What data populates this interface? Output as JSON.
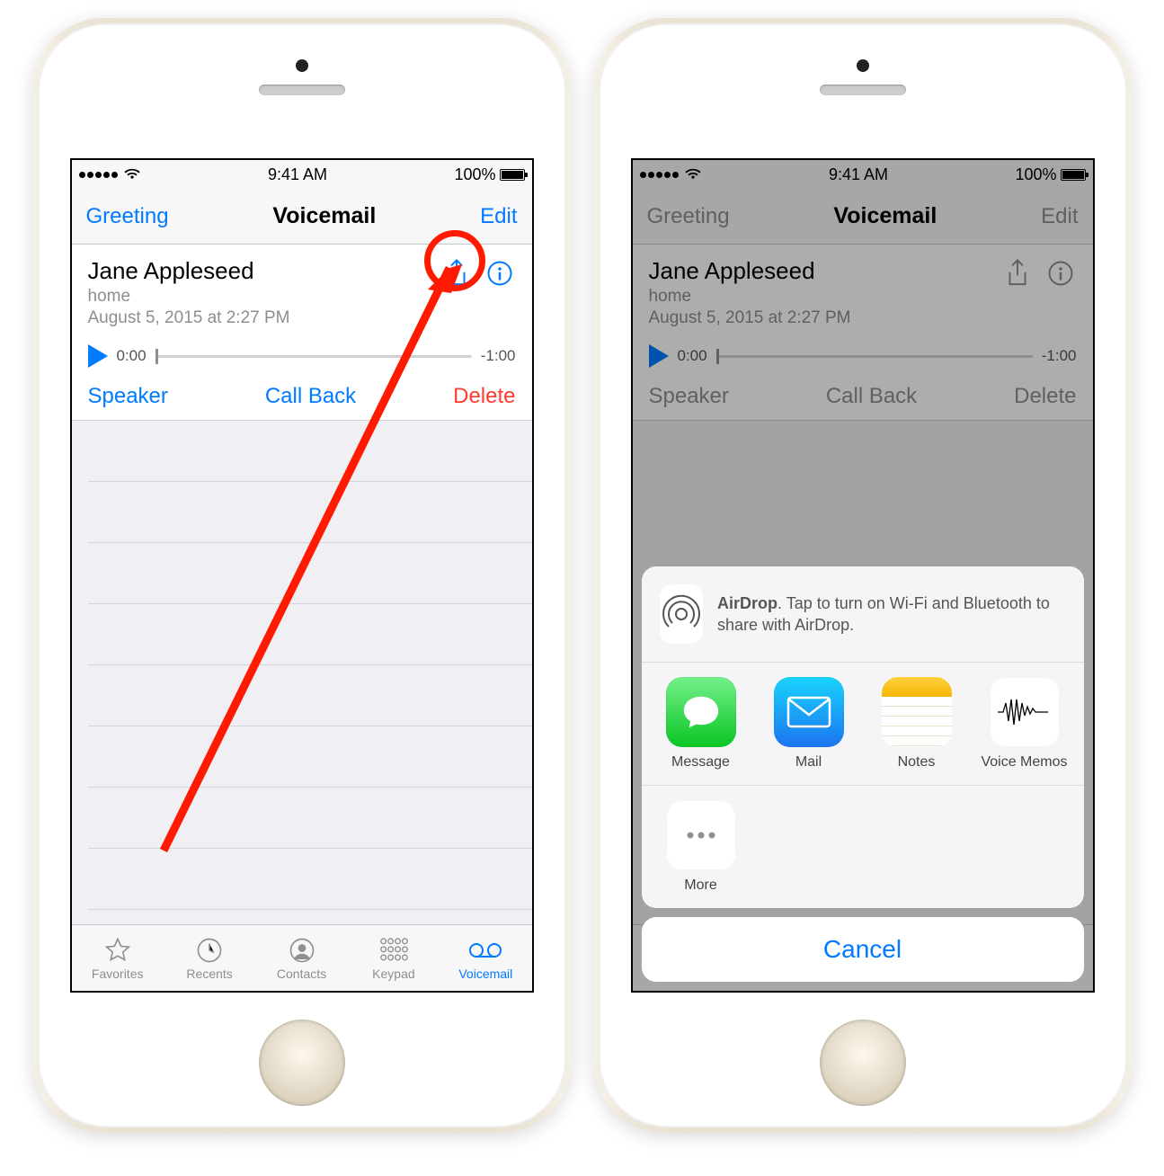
{
  "status": {
    "time": "9:41 AM",
    "battery": "100%"
  },
  "nav": {
    "left": "Greeting",
    "title": "Voicemail",
    "right": "Edit"
  },
  "voicemail": {
    "name": "Jane Appleseed",
    "label": "home",
    "date": "August 5, 2015 at 2:27 PM",
    "elapsed": "0:00",
    "remaining": "-1:00",
    "speaker": "Speaker",
    "callback": "Call Back",
    "delete": "Delete"
  },
  "tabs": {
    "favorites": "Favorites",
    "recents": "Recents",
    "contacts": "Contacts",
    "keypad": "Keypad",
    "voicemail": "Voicemail"
  },
  "share": {
    "airdrop_prefix": "AirDrop",
    "airdrop_text": ". Tap to turn on Wi-Fi and Bluetooth to share with AirDrop.",
    "message": "Message",
    "mail": "Mail",
    "notes": "Notes",
    "voice_memos": "Voice Memos",
    "more": "More",
    "cancel": "Cancel"
  }
}
